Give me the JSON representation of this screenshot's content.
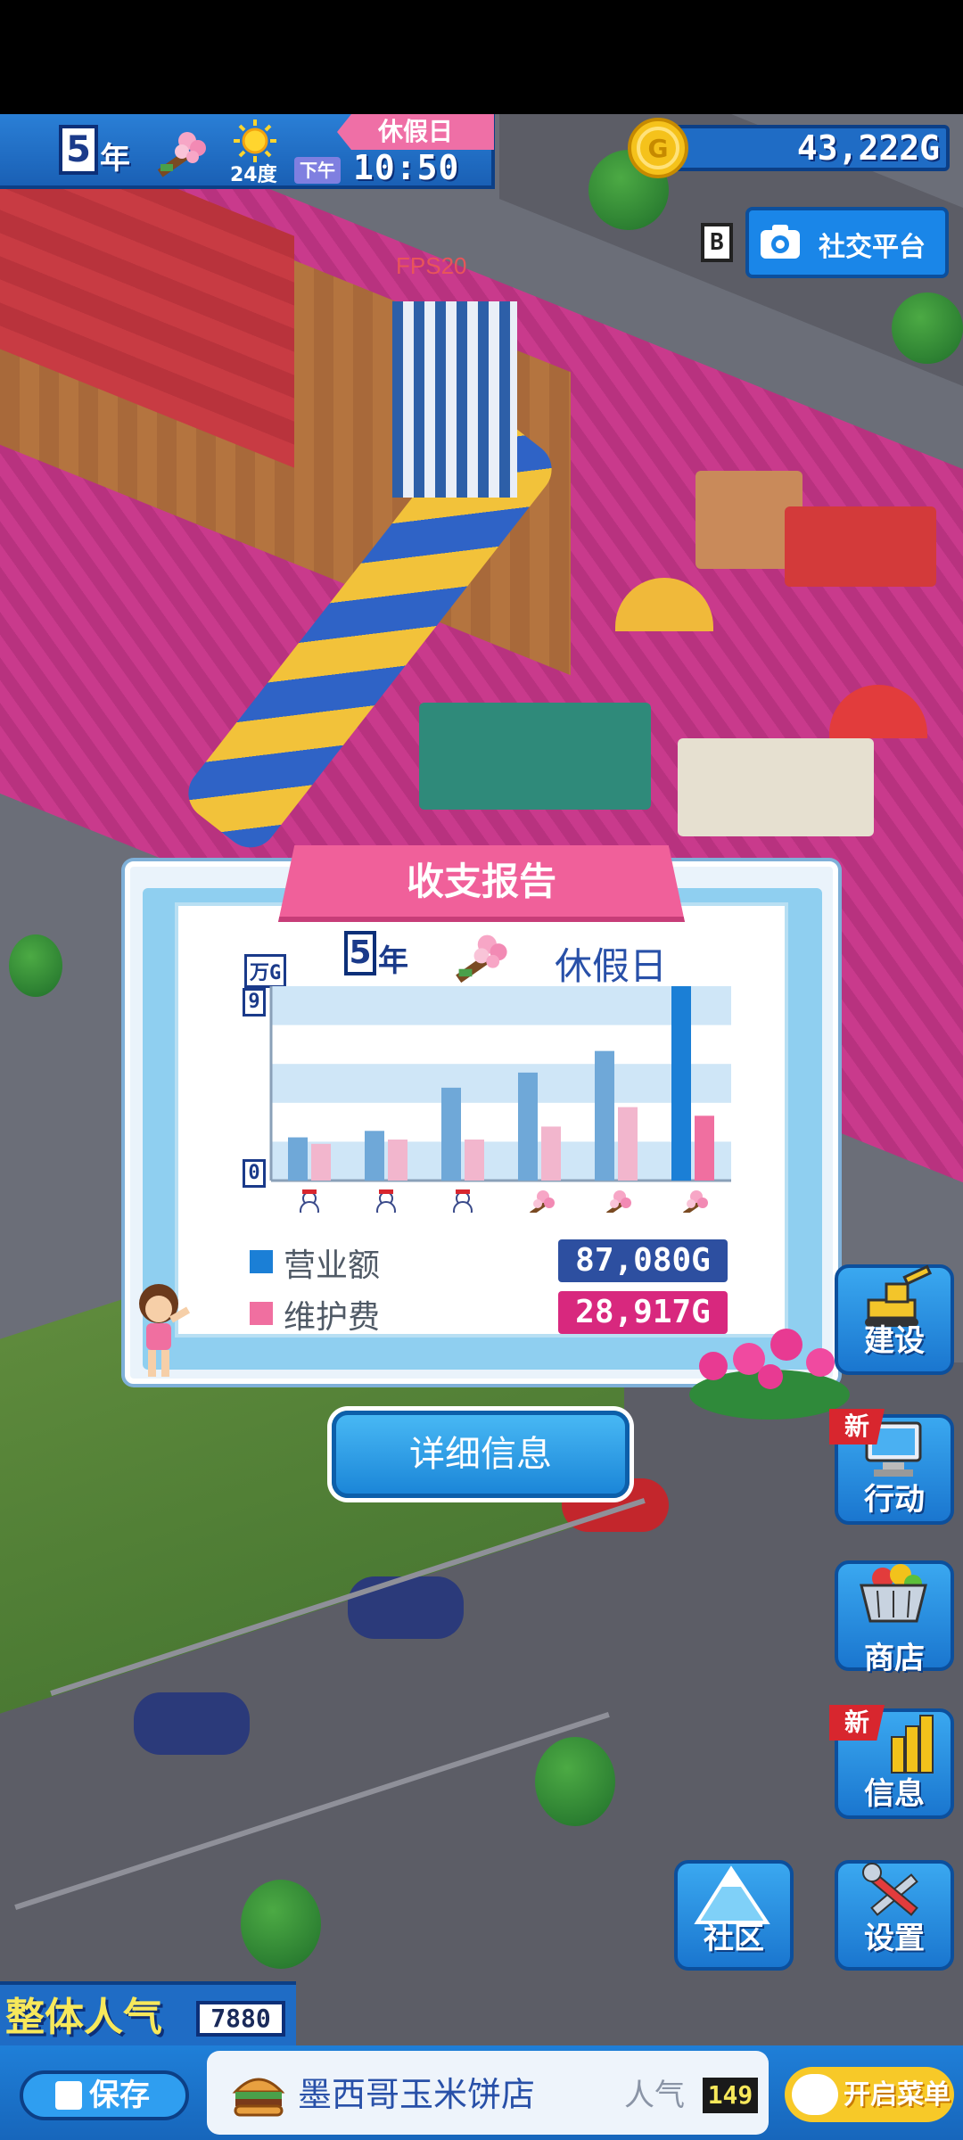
{
  "hud": {
    "year": "5",
    "year_unit": "年",
    "season_icon": "cherry-blossom-icon",
    "weather_icon": "sun-icon",
    "temperature": "24度",
    "ampm": "下午",
    "time": "10:50",
    "day_type": "休假日",
    "money": "43,222G"
  },
  "social": {
    "badge": "B",
    "label": "社交平台",
    "icon": "camera-icon"
  },
  "fps": "FPS20",
  "report": {
    "title": "收支报告",
    "year": "5",
    "year_unit": "年",
    "period_icon": "cherry-blossom-icon",
    "period_name": "休假日",
    "unit_label": "万G",
    "legend_revenue_label": "营业额",
    "legend_revenue_value": "87,080G",
    "legend_upkeep_label": "维护费",
    "legend_upkeep_value": "28,917G",
    "detail_button": "详细信息"
  },
  "chart_data": {
    "type": "bar",
    "unit": "万G",
    "ylim": [
      0,
      9
    ],
    "yticks": [
      "0",
      "9"
    ],
    "categories": [
      "snowman-icon",
      "snowman-icon",
      "snowman-icon",
      "cherry-blossom-icon",
      "cherry-blossom-icon",
      "cherry-blossom-icon"
    ],
    "series": [
      {
        "name": "营业额",
        "color": "#6fa8d8",
        "highlight_color": "#1b7fd6",
        "values": [
          2.0,
          2.3,
          4.3,
          5.0,
          6.0,
          9.0
        ]
      },
      {
        "name": "维护费",
        "color": "#f2b6cd",
        "highlight_color": "#f06fa0",
        "values": [
          1.7,
          1.9,
          1.9,
          2.5,
          3.4,
          3.0
        ]
      }
    ],
    "grid": true,
    "grid_style": "banded"
  },
  "side_buttons": [
    {
      "label": "建设",
      "icon": "excavator-icon",
      "new": false
    },
    {
      "label": "行动",
      "icon": "computer-icon",
      "new": true
    },
    {
      "label": "商店",
      "icon": "shopping-basket-icon",
      "new": false
    },
    {
      "label": "信息",
      "icon": "bar-chart-icon",
      "new": true
    },
    {
      "label": "社区",
      "icon": "mountain-icon",
      "new": false
    },
    {
      "label": "设置",
      "icon": "tools-icon",
      "new": false
    }
  ],
  "new_tag": "新",
  "popularity": {
    "label": "整体人气",
    "value": "7880"
  },
  "bottom": {
    "save_label": "保存",
    "shop_name": "墨西哥玉米饼店",
    "shop_icon": "burger-icon",
    "shop_pop_label": "人气",
    "shop_pop_value": "149",
    "menu_label": "开启菜单"
  },
  "colors": {
    "accent_blue": "#1b7fd6",
    "accent_pink": "#f06fa0",
    "hud_blue": "#1f6cc5",
    "menu_yellow": "#f7c928"
  }
}
